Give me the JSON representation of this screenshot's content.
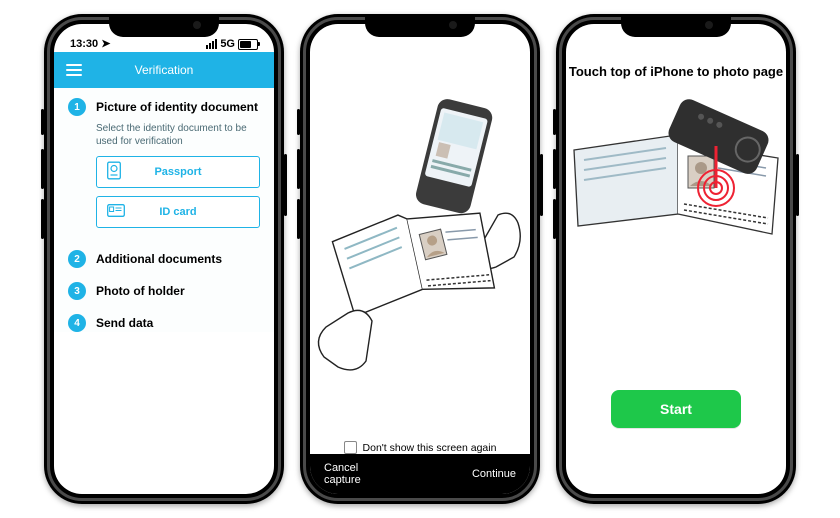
{
  "status": {
    "time": "13:30",
    "network": "5G"
  },
  "appbar": {
    "title": "Verification"
  },
  "steps": {
    "s1": {
      "num": "1",
      "title": "Picture of identity document",
      "desc": "Select the identity document to be used for verification",
      "passport": "Passport",
      "idcard": "ID card"
    },
    "s2": {
      "num": "2",
      "title": "Additional documents"
    },
    "s3": {
      "num": "3",
      "title": "Photo of holder"
    },
    "s4": {
      "num": "4",
      "title": "Send data"
    }
  },
  "screen2": {
    "dontshow": "Don't show this screen again",
    "cancel": "Cancel\ncapture",
    "continue": "Continue"
  },
  "screen3": {
    "title": "Touch top of iPhone to photo page",
    "start": "Start"
  }
}
